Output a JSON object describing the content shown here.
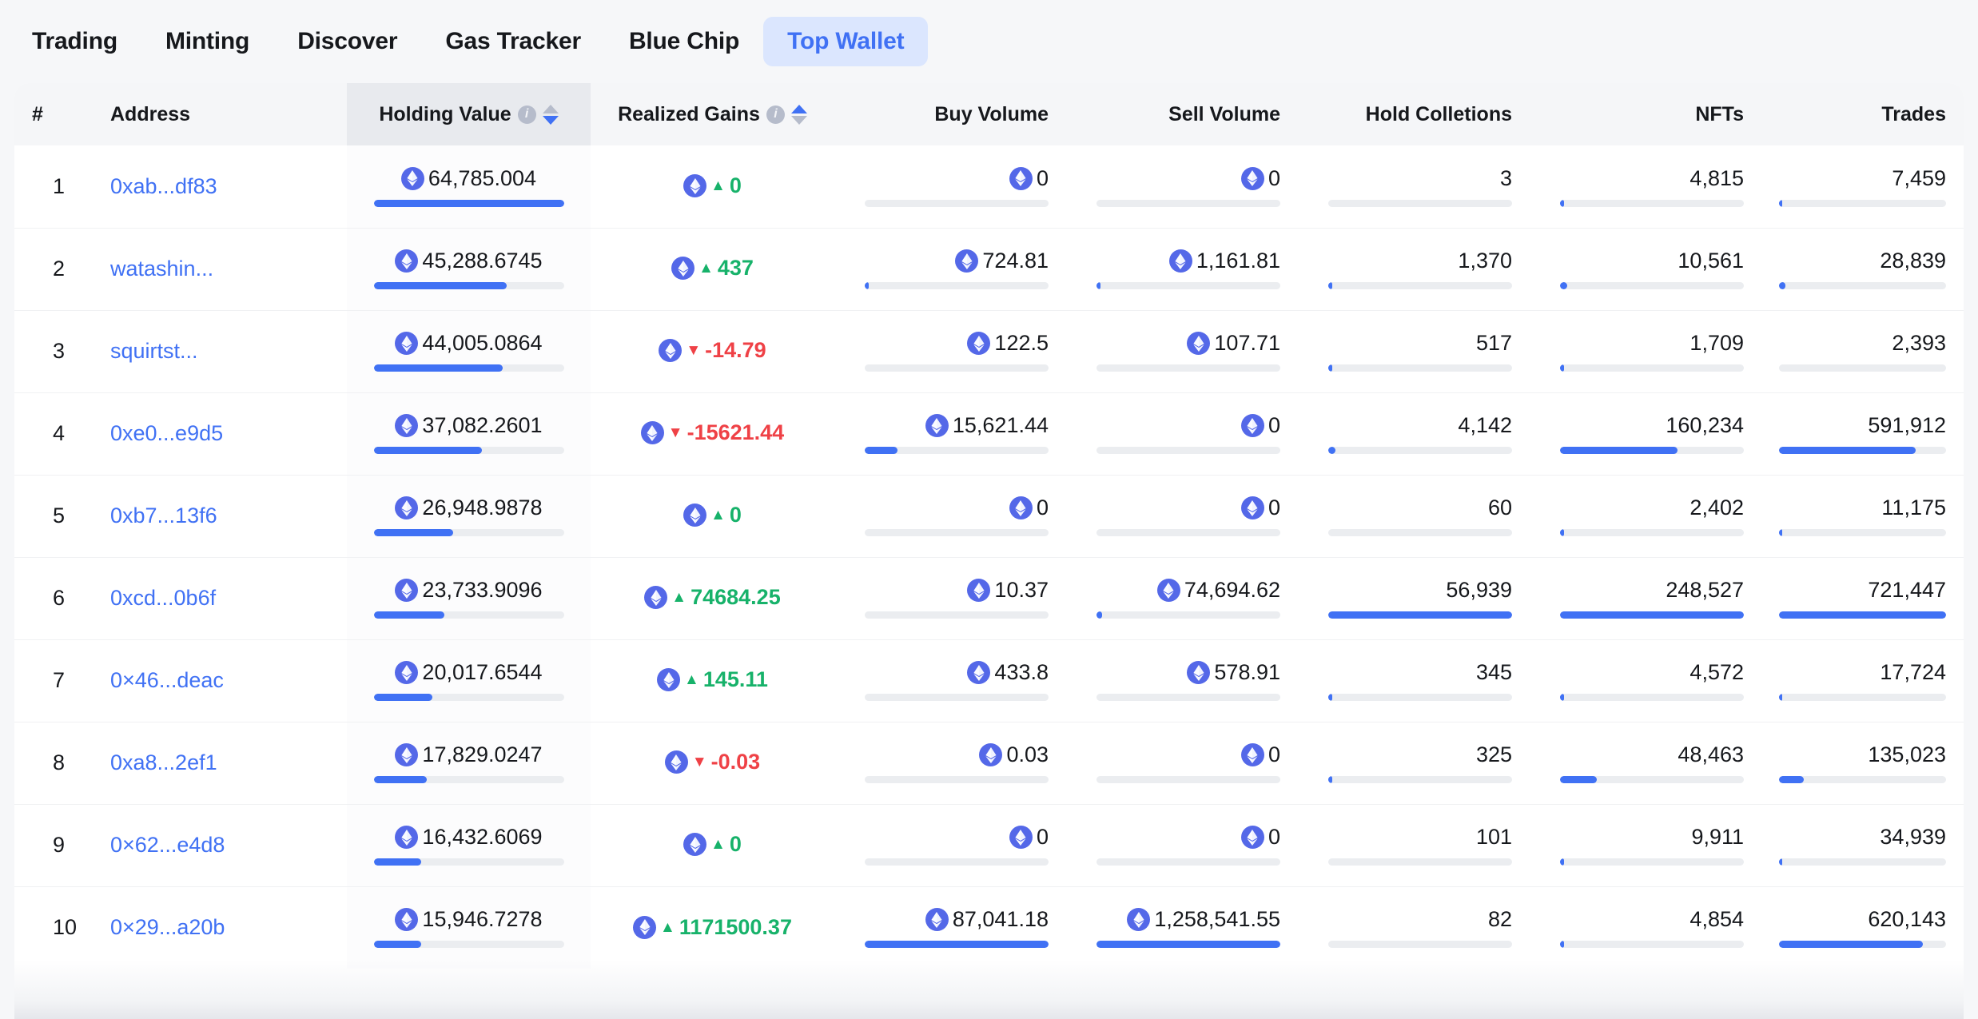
{
  "nav": {
    "items": [
      {
        "label": "Trading",
        "active": false
      },
      {
        "label": "Minting",
        "active": false
      },
      {
        "label": "Discover",
        "active": false
      },
      {
        "label": "Gas Tracker",
        "active": false
      },
      {
        "label": "Blue Chip",
        "active": false
      },
      {
        "label": "Top Wallet",
        "active": true
      }
    ]
  },
  "colors": {
    "accent": "#4071f4",
    "accent_bg": "#dbe6fe",
    "positive": "#17b26a",
    "negative": "#ef4146",
    "eth_coin": "#5468e8",
    "bar_track": "#ebedf0",
    "header_bg": "#f5f6f8",
    "header_sorted_bg": "#e8eaee",
    "page_bg": "#f6f7f9"
  },
  "table": {
    "columns": [
      {
        "key": "rank",
        "label": "#",
        "align": "left",
        "info": false,
        "sort": "none",
        "sorted": false
      },
      {
        "key": "address",
        "label": "Address",
        "align": "left",
        "info": false,
        "sort": "none",
        "sorted": false
      },
      {
        "key": "holding",
        "label": "Holding Value",
        "align": "center",
        "info": true,
        "sort": "desc",
        "sorted": true
      },
      {
        "key": "gains",
        "label": "Realized Gains",
        "align": "center",
        "info": true,
        "sort": "asc",
        "sorted": false
      },
      {
        "key": "buy",
        "label": "Buy Volume",
        "align": "right",
        "info": false,
        "sort": "none",
        "sorted": false
      },
      {
        "key": "sell",
        "label": "Sell Volume",
        "align": "right",
        "info": false,
        "sort": "none",
        "sorted": false
      },
      {
        "key": "collections",
        "label": "Hold Colletions",
        "align": "right",
        "info": false,
        "sort": "none",
        "sorted": false
      },
      {
        "key": "nfts",
        "label": "NFTs",
        "align": "right",
        "info": false,
        "sort": "none",
        "sorted": false
      },
      {
        "key": "trades",
        "label": "Trades",
        "align": "right",
        "info": false,
        "sort": "none",
        "sorted": false
      }
    ],
    "rows": [
      {
        "rank": "1",
        "address": "0xab...df83",
        "holding": {
          "value": "64,785.004",
          "eth": true,
          "bar": 100
        },
        "gains": {
          "value": "0",
          "eth": true,
          "dir": "up",
          "sign": "pos"
        },
        "buy": {
          "value": "0",
          "eth": true,
          "bar": 0
        },
        "sell": {
          "value": "0",
          "eth": true,
          "bar": 0
        },
        "collections": {
          "value": "3",
          "eth": false,
          "bar": 0
        },
        "nfts": {
          "value": "4,815",
          "eth": false,
          "bar": 2
        },
        "trades": {
          "value": "7,459",
          "eth": false,
          "bar": 1
        }
      },
      {
        "rank": "2",
        "address": "watashin...",
        "holding": {
          "value": "45,288.6745",
          "eth": true,
          "bar": 70
        },
        "gains": {
          "value": "437",
          "eth": true,
          "dir": "up",
          "sign": "pos"
        },
        "buy": {
          "value": "724.81",
          "eth": true,
          "bar": 1
        },
        "sell": {
          "value": "1,161.81",
          "eth": true,
          "bar": 1
        },
        "collections": {
          "value": "1,370",
          "eth": false,
          "bar": 2
        },
        "nfts": {
          "value": "10,561",
          "eth": false,
          "bar": 4
        },
        "trades": {
          "value": "28,839",
          "eth": false,
          "bar": 4
        }
      },
      {
        "rank": "3",
        "address": "squirtst...",
        "holding": {
          "value": "44,005.0864",
          "eth": true,
          "bar": 68
        },
        "gains": {
          "value": "-14.79",
          "eth": true,
          "dir": "down",
          "sign": "neg"
        },
        "buy": {
          "value": "122.5",
          "eth": true,
          "bar": 0
        },
        "sell": {
          "value": "107.71",
          "eth": true,
          "bar": 0
        },
        "collections": {
          "value": "517",
          "eth": false,
          "bar": 1
        },
        "nfts": {
          "value": "1,709",
          "eth": false,
          "bar": 1
        },
        "trades": {
          "value": "2,393",
          "eth": false,
          "bar": 0
        }
      },
      {
        "rank": "4",
        "address": "0xe0...e9d5",
        "holding": {
          "value": "37,082.2601",
          "eth": true,
          "bar": 57
        },
        "gains": {
          "value": "-15621.44",
          "eth": true,
          "dir": "down",
          "sign": "neg"
        },
        "buy": {
          "value": "15,621.44",
          "eth": true,
          "bar": 18
        },
        "sell": {
          "value": "0",
          "eth": true,
          "bar": 0
        },
        "collections": {
          "value": "4,142",
          "eth": false,
          "bar": 4
        },
        "nfts": {
          "value": "160,234",
          "eth": false,
          "bar": 64
        },
        "trades": {
          "value": "591,912",
          "eth": false,
          "bar": 82
        }
      },
      {
        "rank": "5",
        "address": "0xb7...13f6",
        "holding": {
          "value": "26,948.9878",
          "eth": true,
          "bar": 42
        },
        "gains": {
          "value": "0",
          "eth": true,
          "dir": "up",
          "sign": "pos"
        },
        "buy": {
          "value": "0",
          "eth": true,
          "bar": 0
        },
        "sell": {
          "value": "0",
          "eth": true,
          "bar": 0
        },
        "collections": {
          "value": "60",
          "eth": false,
          "bar": 0
        },
        "nfts": {
          "value": "2,402",
          "eth": false,
          "bar": 1
        },
        "trades": {
          "value": "11,175",
          "eth": false,
          "bar": 2
        }
      },
      {
        "rank": "6",
        "address": "0xcd...0b6f",
        "holding": {
          "value": "23,733.9096",
          "eth": true,
          "bar": 37
        },
        "gains": {
          "value": "74684.25",
          "eth": true,
          "dir": "up",
          "sign": "pos"
        },
        "buy": {
          "value": "10.37",
          "eth": true,
          "bar": 0
        },
        "sell": {
          "value": "74,694.62",
          "eth": true,
          "bar": 3
        },
        "collections": {
          "value": "56,939",
          "eth": false,
          "bar": 100
        },
        "nfts": {
          "value": "248,527",
          "eth": false,
          "bar": 100
        },
        "trades": {
          "value": "721,447",
          "eth": false,
          "bar": 100
        }
      },
      {
        "rank": "7",
        "address": "0×46...deac",
        "holding": {
          "value": "20,017.6544",
          "eth": true,
          "bar": 31
        },
        "gains": {
          "value": "145.11",
          "eth": true,
          "dir": "up",
          "sign": "pos"
        },
        "buy": {
          "value": "433.8",
          "eth": true,
          "bar": 0
        },
        "sell": {
          "value": "578.91",
          "eth": true,
          "bar": 0
        },
        "collections": {
          "value": "345",
          "eth": false,
          "bar": 1
        },
        "nfts": {
          "value": "4,572",
          "eth": false,
          "bar": 2
        },
        "trades": {
          "value": "17,724",
          "eth": false,
          "bar": 2
        }
      },
      {
        "rank": "8",
        "address": "0xa8...2ef1",
        "holding": {
          "value": "17,829.0247",
          "eth": true,
          "bar": 28
        },
        "gains": {
          "value": "-0.03",
          "eth": true,
          "dir": "down",
          "sign": "neg"
        },
        "buy": {
          "value": "0.03",
          "eth": true,
          "bar": 0
        },
        "sell": {
          "value": "0",
          "eth": true,
          "bar": 0
        },
        "collections": {
          "value": "325",
          "eth": false,
          "bar": 1
        },
        "nfts": {
          "value": "48,463",
          "eth": false,
          "bar": 20
        },
        "trades": {
          "value": "135,023",
          "eth": false,
          "bar": 15
        }
      },
      {
        "rank": "9",
        "address": "0×62...e4d8",
        "holding": {
          "value": "16,432.6069",
          "eth": true,
          "bar": 25
        },
        "gains": {
          "value": "0",
          "eth": true,
          "dir": "up",
          "sign": "pos"
        },
        "buy": {
          "value": "0",
          "eth": true,
          "bar": 0
        },
        "sell": {
          "value": "0",
          "eth": true,
          "bar": 0
        },
        "collections": {
          "value": "101",
          "eth": false,
          "bar": 0
        },
        "nfts": {
          "value": "9,911",
          "eth": false,
          "bar": 2
        },
        "trades": {
          "value": "34,939",
          "eth": false,
          "bar": 1
        }
      },
      {
        "rank": "10",
        "address": "0×29...a20b",
        "holding": {
          "value": "15,946.7278",
          "eth": true,
          "bar": 25
        },
        "gains": {
          "value": "1171500.37",
          "eth": true,
          "dir": "up",
          "sign": "pos"
        },
        "buy": {
          "value": "87,041.18",
          "eth": true,
          "bar": 100
        },
        "sell": {
          "value": "1,258,541.55",
          "eth": true,
          "bar": 100
        },
        "collections": {
          "value": "82",
          "eth": false,
          "bar": 0
        },
        "nfts": {
          "value": "4,854",
          "eth": false,
          "bar": 2
        },
        "trades": {
          "value": "620,143",
          "eth": false,
          "bar": 86
        }
      }
    ]
  },
  "icons": {
    "info": "info-icon",
    "sort": "sort-arrows-icon",
    "eth": "ethereum-coin-icon",
    "up": "▲",
    "down": "▼"
  }
}
